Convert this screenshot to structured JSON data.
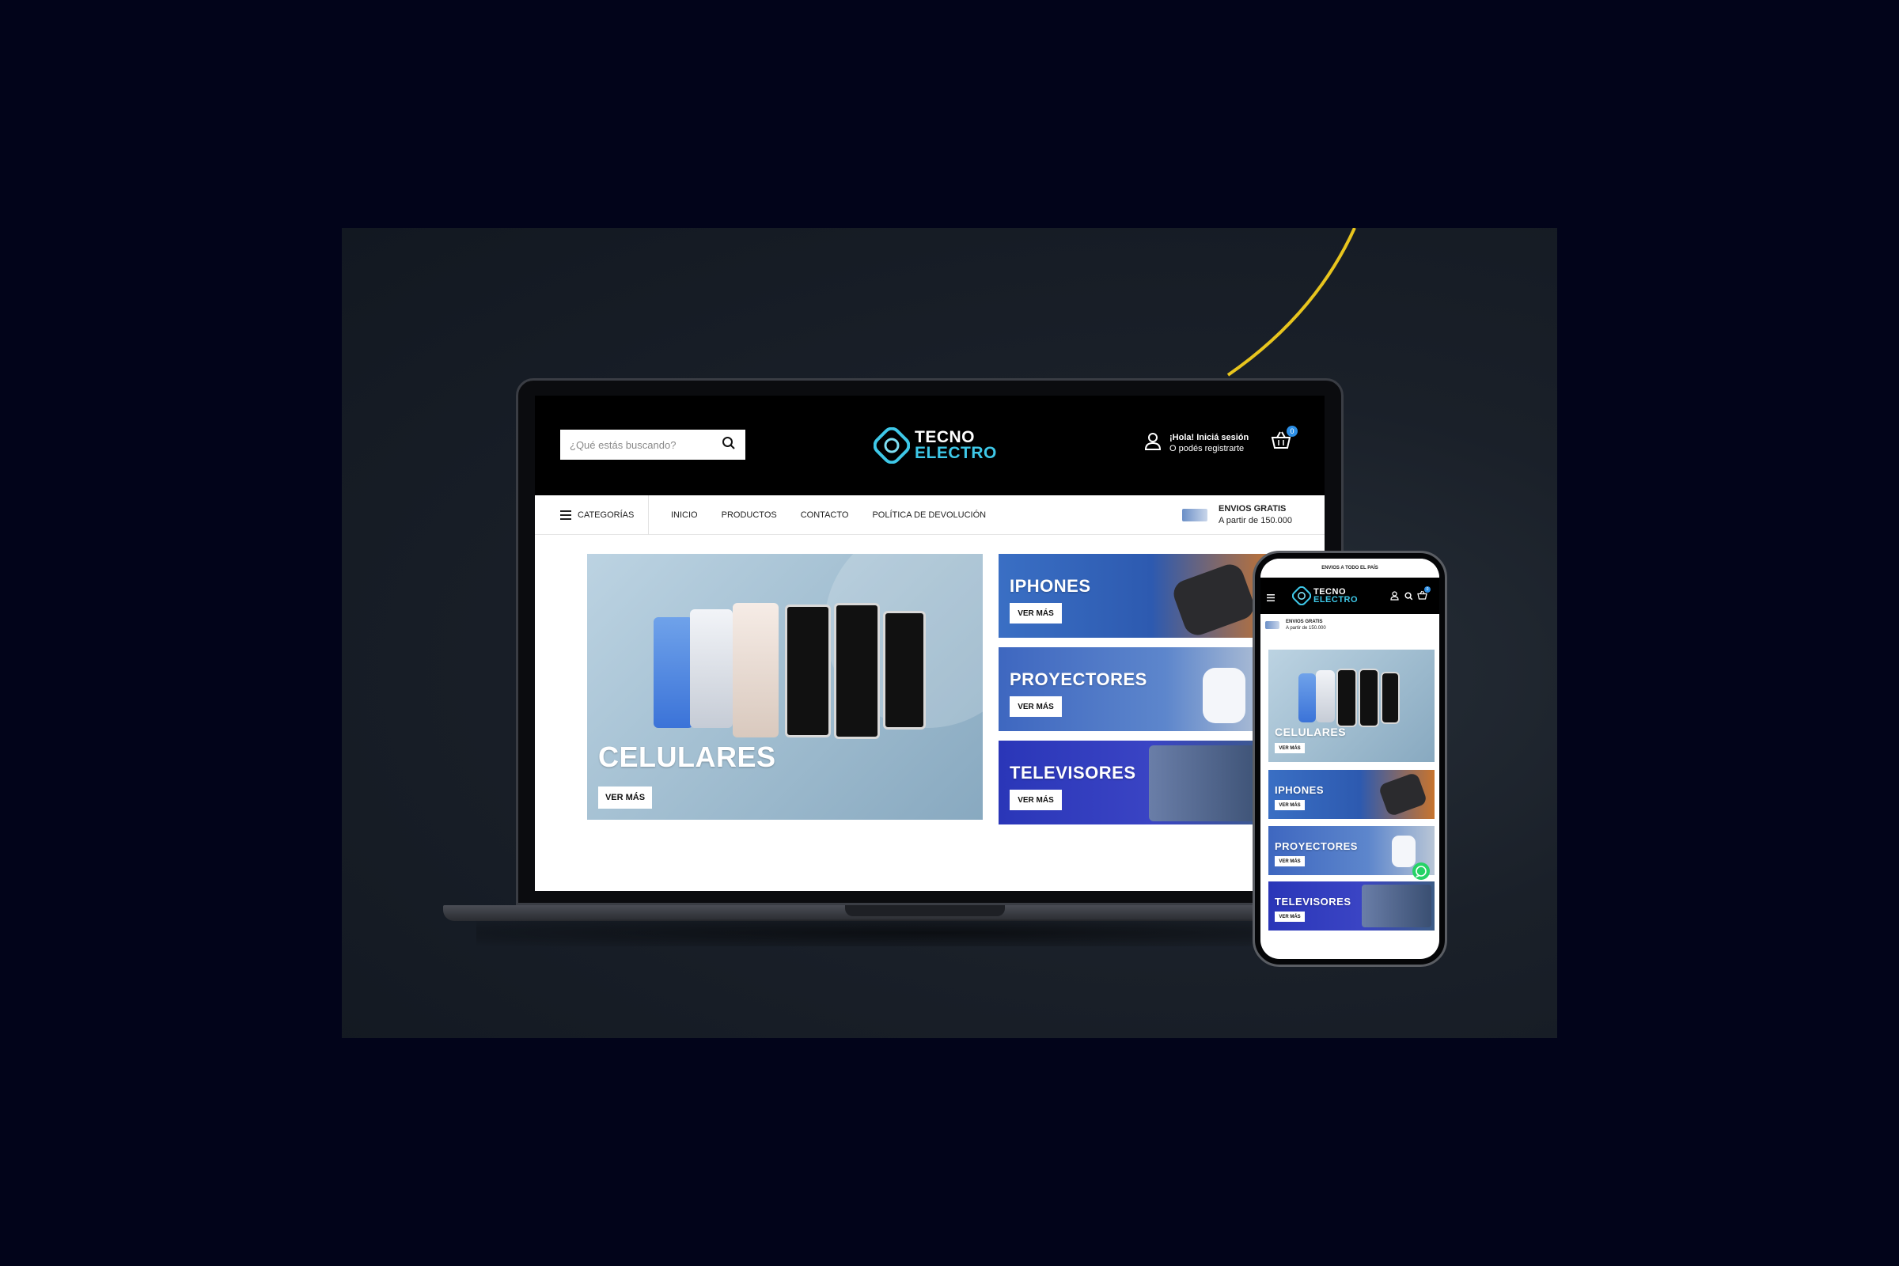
{
  "colors": {
    "page_bg": "#02041a",
    "accent_cyan": "#3ec8e8",
    "header_bg": "#000000",
    "cart_badge": "#2c8fe6",
    "arc_yellow": "#e8c51e",
    "whatsapp": "#25d366"
  },
  "desktop": {
    "search": {
      "placeholder": "¿Qué estás buscando?"
    },
    "logo": {
      "line1": "TECNO",
      "line2": "ELECTRO"
    },
    "account": {
      "greeting": "¡Hola! Iniciá sesión",
      "sub": "O podés registrarte"
    },
    "cart": {
      "count": "0"
    },
    "nav": {
      "categories_label": "CATEGORÍAS",
      "items": [
        "INICIO",
        "PRODUCTOS",
        "CONTACTO",
        "POLÍTICA DE DEVOLUCIÓN"
      ]
    },
    "shipping": {
      "title": "ENVIOS GRATIS",
      "subtitle": "A partir de 150.000"
    },
    "banners": [
      {
        "title": "CELULARES",
        "button": "VER MÁS"
      },
      {
        "title": "IPHONES",
        "button": "VER MÁS"
      },
      {
        "title": "PROYECTORES",
        "button": "VER MÁS"
      },
      {
        "title": "TELEVISORES",
        "button": "VER MÁS"
      }
    ]
  },
  "mobile": {
    "topbar": "ENVIOS A TODO EL PAÍS",
    "logo": {
      "line1": "TECNO",
      "line2": "ELECTRO"
    },
    "cart": {
      "count": "0"
    },
    "shipping": {
      "title": "ENVIOS GRATIS",
      "subtitle": "A partir de 150.000"
    },
    "banners": [
      {
        "title": "CELULARES",
        "button": "VER MÁS"
      },
      {
        "title": "IPHONES",
        "button": "VER MÁS"
      },
      {
        "title": "PROYECTORES",
        "button": "VER MÁS"
      },
      {
        "title": "TELEVISORES",
        "button": "VER MÁS"
      }
    ]
  },
  "icons": {
    "search": "search-icon",
    "user": "user-icon",
    "cart": "basket-icon",
    "menu": "hamburger-icon",
    "whatsapp": "whatsapp-icon"
  }
}
